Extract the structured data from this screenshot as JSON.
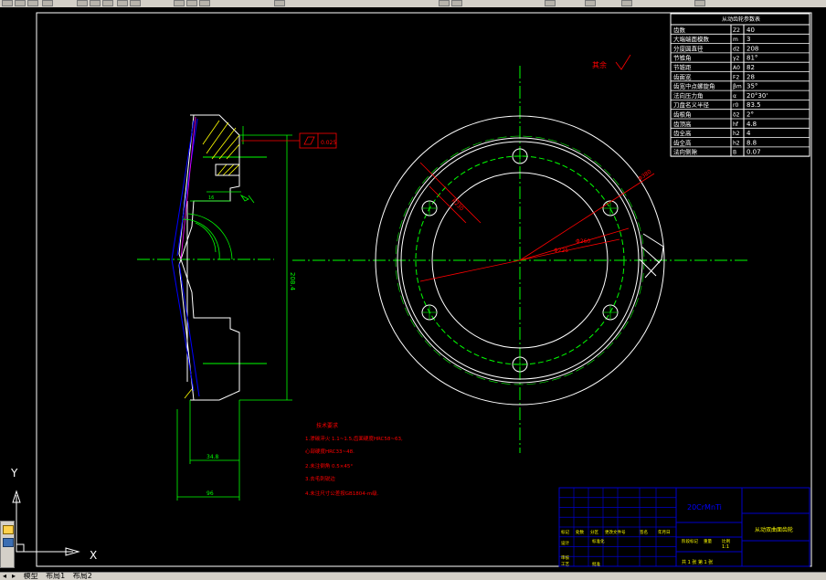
{
  "model_tab": "模型",
  "layout_tabs": [
    "布局1",
    "布局2"
  ],
  "axis_labels": {
    "y": "Y",
    "x": "X"
  },
  "params_table": {
    "title": "从动齿轮参数表",
    "rows": [
      {
        "name": "齿数",
        "sym": "Z2",
        "val": "40"
      },
      {
        "name": "大端端面模数",
        "sym": "m",
        "val": "3"
      },
      {
        "name": "分度圆直径",
        "sym": "d2",
        "val": "208"
      },
      {
        "name": "节锥角",
        "sym": "γ2",
        "val": "81°"
      },
      {
        "name": "节锥距",
        "sym": "A0",
        "val": "82"
      },
      {
        "name": "齿面宽",
        "sym": "F2",
        "val": "28"
      },
      {
        "name": "齿宽中点螺旋角",
        "sym": "βm",
        "val": "35°"
      },
      {
        "name": "法向压力角",
        "sym": "α",
        "val": "20°30'"
      },
      {
        "name": "刀盘名义半径",
        "sym": "r0",
        "val": "83.5"
      },
      {
        "name": "齿根角",
        "sym": "δ2",
        "val": "2°"
      },
      {
        "name": "齿顶高",
        "sym": "hf",
        "val": "4.8"
      },
      {
        "name": "齿全高",
        "sym": "h2",
        "val": "4"
      },
      {
        "name": "齿全高",
        "sym": "h2",
        "val": "8.8"
      },
      {
        "name": "法向侧隙",
        "sym": "B",
        "val": "0.07"
      }
    ]
  },
  "roughness_note": "其余",
  "tolerance_box": "0.025",
  "dims": {
    "height": "208.4",
    "width1": "34.8",
    "width2": "96",
    "small1": "16",
    "radius1": "R230",
    "dia1": "Φ225",
    "dia2": "Φ260",
    "dia3": "Φ380"
  },
  "tech_notes": {
    "title": "技术要求",
    "items": [
      "1.渗碳淬火 1.1~1.5,齿面硬度HRC58~63,",
      "  心部硬度HRC33~48.",
      "2.未注倒角 0.5×45°",
      "3.去毛刺锐边",
      "4.未注尺寸公差按GB1804-m级."
    ]
  },
  "title_block": {
    "material": "20CrMnTi",
    "part_name": "从动双曲面齿轮",
    "cells": [
      "标记",
      "处数",
      "分区",
      "更改文件号",
      "签名",
      "年月日",
      "设计",
      "标准化",
      "阶段标记",
      "重量",
      "比例",
      "审核",
      "工艺",
      "批准"
    ],
    "scale": "1:1",
    "sheet": "共 1 张 第 1 张"
  },
  "colors": {
    "background": "#000000",
    "geometry": "#ffffff",
    "centerline": "#00ff00",
    "dimension": "#ff0000",
    "hidden": "#0000ff",
    "hatch": "#ffff00",
    "titleblock": "#0000cc"
  }
}
